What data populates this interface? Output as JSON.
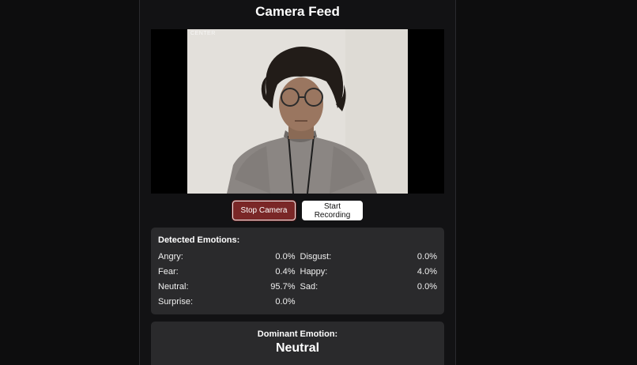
{
  "page": {
    "title": "Camera Feed"
  },
  "video": {
    "overlay_label": "CENTER"
  },
  "controls": {
    "stop_camera_label": "Stop Camera",
    "start_recording_label": "Start Recording"
  },
  "emotions": {
    "heading": "Detected Emotions:",
    "items": [
      {
        "label": "Angry:",
        "value": "0.0%"
      },
      {
        "label": "Disgust:",
        "value": "0.0%"
      },
      {
        "label": "Fear:",
        "value": "0.4%"
      },
      {
        "label": "Happy:",
        "value": "4.0%"
      },
      {
        "label": "Neutral:",
        "value": "95.7%"
      },
      {
        "label": "Sad:",
        "value": "0.0%"
      },
      {
        "label": "Surprise:",
        "value": "0.0%"
      }
    ]
  },
  "dominant": {
    "heading": "Dominant Emotion:",
    "value": "Neutral"
  },
  "colors": {
    "background": "#0d0d0e",
    "panel": "#121214",
    "card": "#2a2a2c",
    "stop_button": "#7a2727",
    "record_button": "#ffffff"
  }
}
